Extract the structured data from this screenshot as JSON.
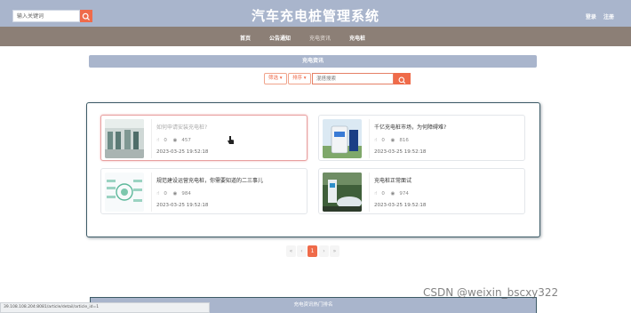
{
  "header": {
    "search_placeholder": "输入关键词",
    "title": "汽车充电桩管理系统",
    "login": "登录",
    "register": "注册"
  },
  "nav": {
    "items": [
      {
        "label": "首页",
        "state": "active"
      },
      {
        "label": "公告通知",
        "state": "active"
      },
      {
        "label": "充电资讯",
        "state": "muted"
      },
      {
        "label": "充电桩",
        "state": "active"
      }
    ]
  },
  "section": {
    "title": "充电资讯"
  },
  "filters": {
    "filter_label": "筛选",
    "sort_label": "排序",
    "search_placeholder": "混搭搜索"
  },
  "articles": [
    {
      "title": "如何申请安装充电桩?",
      "likes": "0",
      "views": "457",
      "time": "2023-03-25 19:52:18",
      "thumb": "station-indoor"
    },
    {
      "title": "千亿充电桩市场，为何障碍难?",
      "likes": "0",
      "views": "816",
      "time": "2023-03-25 19:52:18",
      "thumb": "charger-kiosk"
    },
    {
      "title": "规范建设运营充电桩，你需要知道的二三事儿",
      "likes": "0",
      "views": "984",
      "time": "2023-03-25 19:52:18",
      "thumb": "diagram"
    },
    {
      "title": "充电桩正常面试",
      "likes": "0",
      "views": "974",
      "time": "2023-03-25 19:52:18",
      "thumb": "car-charging"
    }
  ],
  "pagination": {
    "first": "«",
    "prev": "‹",
    "current": "1",
    "next": "›",
    "last": "»"
  },
  "footer": {
    "bottom_section_title": "充电资讯热门排名",
    "status_url": "39.108.108.204:8081/article/detail/article_id=1",
    "watermark": "CSDN @weixin_bscxy322"
  },
  "colors": {
    "header_bg": "#a9b5cc",
    "nav_bg": "#8c7f76",
    "accent": "#ef6b4a",
    "panel_border": "#3c5a66"
  },
  "icons": {
    "search": "search-icon",
    "like": "thumbs-up-icon",
    "views": "eye-icon",
    "dropdown": "caret-down-icon"
  }
}
